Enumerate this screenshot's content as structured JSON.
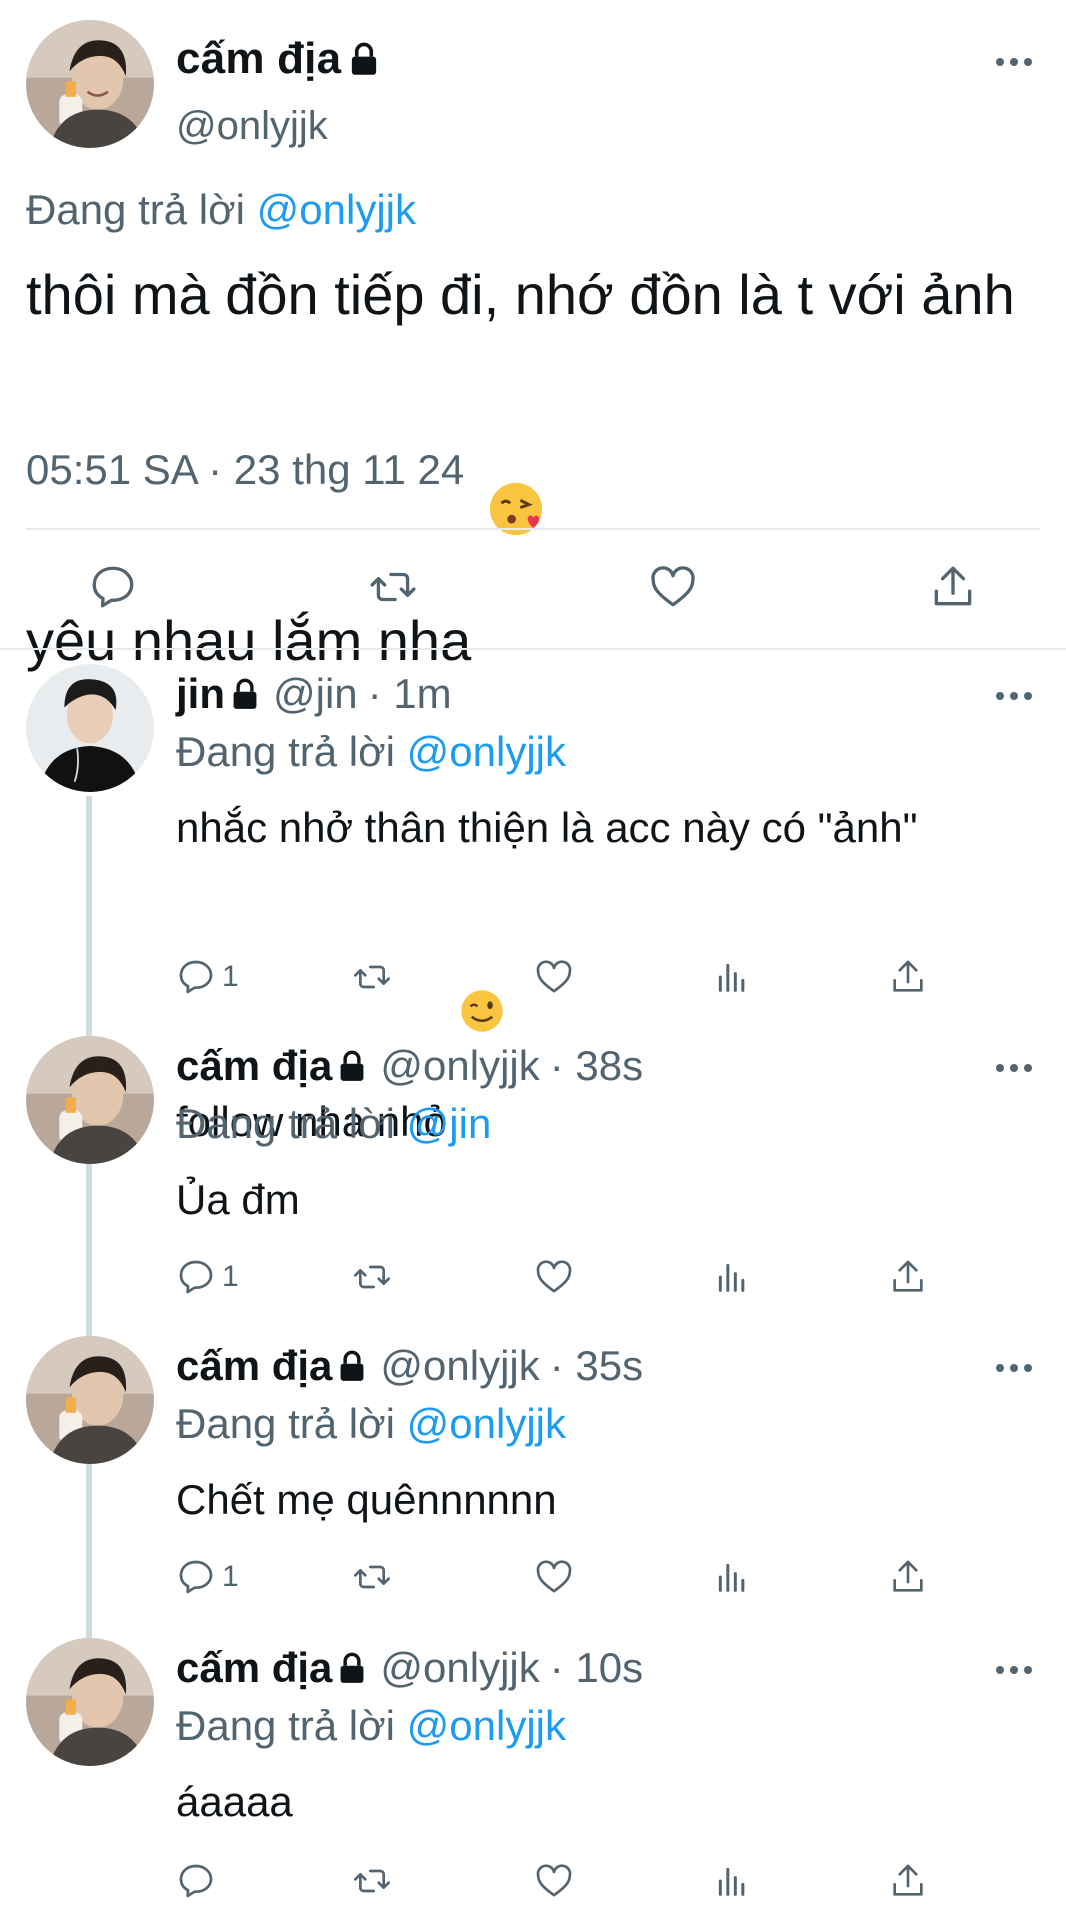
{
  "main_tweet": {
    "author": {
      "name": "cấm địa",
      "handle": "@onlyjjk"
    },
    "reply_prefix": "Đang trả lời",
    "reply_to": "@onlyjjk",
    "text": "thôi mà đồn tiếp đi, nhớ đồn là t với ảnh yêu nhau lắm nha",
    "emoji": "face-blowing-kiss-emoji",
    "timestamp": "05:51 SA · 23 thg 11 24",
    "actions": [
      "reply-icon",
      "retweet-icon",
      "like-icon",
      "share-icon"
    ]
  },
  "replies": [
    {
      "name": "jin",
      "handle": "@jin",
      "time": "· 1m",
      "reply_prefix": "Đang trả lời",
      "reply_to": "@onlyjjk",
      "text": "nhắc nhở thân thiện là acc này có \"ảnh\" follow nha nhỏ",
      "emoji": "winking-face-emoji",
      "reply_count": "1"
    },
    {
      "name": "cấm địa",
      "handle": "@onlyjjk",
      "time": "· 38s",
      "reply_prefix": "Đang trả lời",
      "reply_to": "@jin",
      "text": "Ủa đm",
      "reply_count": "1"
    },
    {
      "name": "cấm địa",
      "handle": "@onlyjjk",
      "time": "· 35s",
      "reply_prefix": "Đang trả lời",
      "reply_to": "@onlyjjk",
      "text": "Chết mẹ quênnnnnn",
      "reply_count": "1"
    },
    {
      "name": "cấm địa",
      "handle": "@onlyjjk",
      "time": "· 10s",
      "reply_prefix": "Đang trả lời",
      "reply_to": "@onlyjjk",
      "text": "áaaaa",
      "reply_count": ""
    }
  ],
  "colors": {
    "text": "#0f1419",
    "muted": "#536471",
    "link": "#1d9bf0",
    "divider": "#e7eaec",
    "thread_line": "#cfd9de"
  }
}
